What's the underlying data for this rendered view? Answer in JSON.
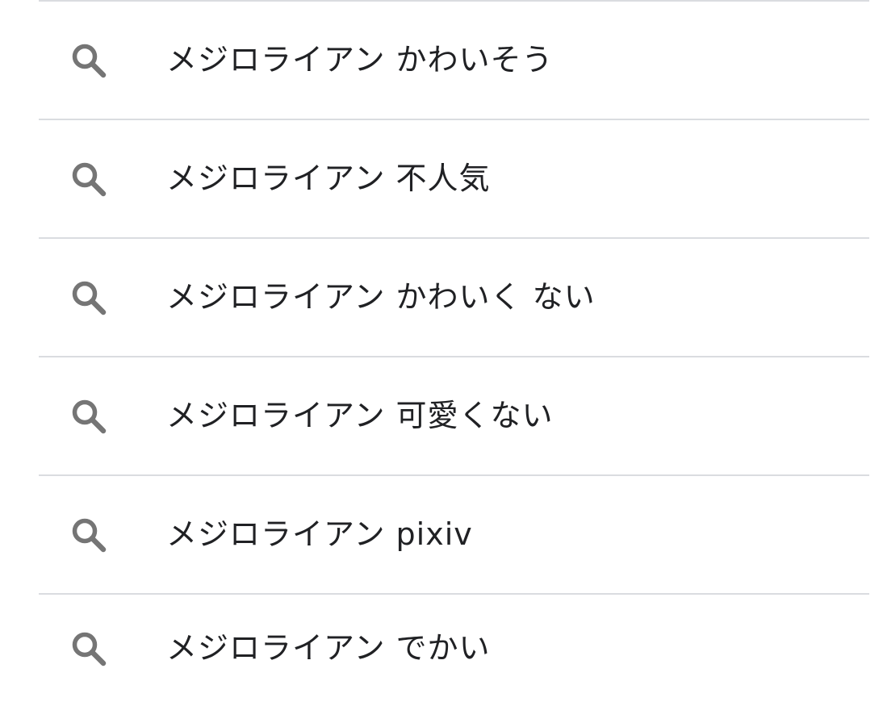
{
  "suggestions": {
    "icon": "search-icon",
    "icon_color": "#757575",
    "divider_color": "#dadce0",
    "items": [
      {
        "label": "メジロライアン かわいそう"
      },
      {
        "label": "メジロライアン 不人気"
      },
      {
        "label": "メジロライアン かわいく ない"
      },
      {
        "label": "メジロライアン 可愛くない"
      },
      {
        "label": "メジロライアン pixiv"
      },
      {
        "label": "メジロライアン でかい"
      }
    ]
  }
}
